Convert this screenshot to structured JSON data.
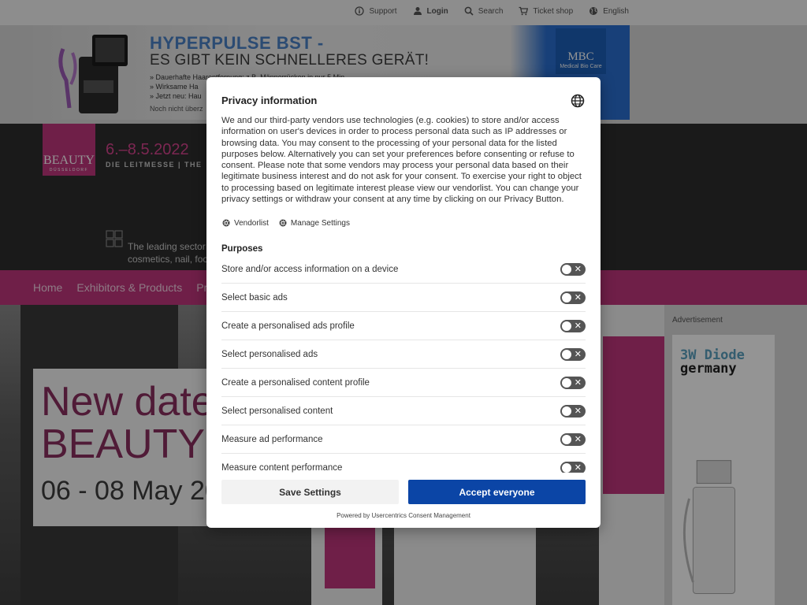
{
  "topnav": {
    "items": [
      {
        "icon": "info-icon",
        "label": "Support"
      },
      {
        "icon": "user-icon",
        "label": "Login"
      },
      {
        "icon": "search-icon",
        "label": "Search"
      },
      {
        "icon": "cart-icon",
        "label": "Ticket shop"
      },
      {
        "icon": "globe-icon",
        "label": "English"
      }
    ]
  },
  "banner": {
    "title": "HYPERPULSE BST -",
    "subtitle": "ES GIBT KEIN SCHNELLERES GERÄT!",
    "bullets": [
      "» Dauerhafte Haarentfernung: z.B. Männerrücken in nur 5 Min",
      "» Wirksame Ha",
      "» Jetzt neu: Hau"
    ],
    "note": "Noch nicht überz",
    "brand": "MBC",
    "brand_sub": "Medical Bio Care"
  },
  "header": {
    "logo_text": "BEAUTY",
    "logo_sub": "DÜSSELDORF",
    "dates": "6.–8.5.2022",
    "tagline": "DIE LEITMESSE | THE",
    "sector_line1": "The leading sector",
    "sector_line2": "cosmetics, nail, foot"
  },
  "mainnav": {
    "items": [
      "Home",
      "Exhibitors & Products",
      "Pro"
    ]
  },
  "hero": {
    "line1": "New date",
    "line2": "BEAUTY 2",
    "line3": "06 - 08 May 20"
  },
  "ad": {
    "label": "Advertisement",
    "brand1": "3W Diode",
    "brand2": "germany"
  },
  "modal": {
    "title": "Privacy information",
    "description": "We and our third-party vendors use technologies (e.g. cookies) to store and/or access information on user's devices in order to process personal data such as IP addresses or browsing data. You may consent to the processing of your personal data for the listed purposes below. Alternatively you can set your preferences before consenting or refuse to consent. Please note that some vendors may process your personal data based on their legitimate business interest and do not ask for your consent. To exercise your right to object to processing based on legitimate interest please view our vendorlist. You can change your privacy settings or withdraw your consent at any time by clicking on our Privacy Button.",
    "vendorlist_label": "Vendorlist",
    "manage_label": "Manage Settings",
    "purposes_heading": "Purposes",
    "purposes": [
      {
        "label": "Store and/or access information on a device",
        "enabled": false
      },
      {
        "label": "Select basic ads",
        "enabled": false
      },
      {
        "label": "Create a personalised ads profile",
        "enabled": false
      },
      {
        "label": "Select personalised ads",
        "enabled": false
      },
      {
        "label": "Create a personalised content profile",
        "enabled": false
      },
      {
        "label": "Select personalised content",
        "enabled": false
      },
      {
        "label": "Measure ad performance",
        "enabled": false
      },
      {
        "label": "Measure content performance",
        "enabled": false
      }
    ],
    "save_label": "Save Settings",
    "accept_label": "Accept everyone",
    "powered_by": "Powered by Usercentrics Consent Management",
    "accent_color": "#0b45a6"
  }
}
